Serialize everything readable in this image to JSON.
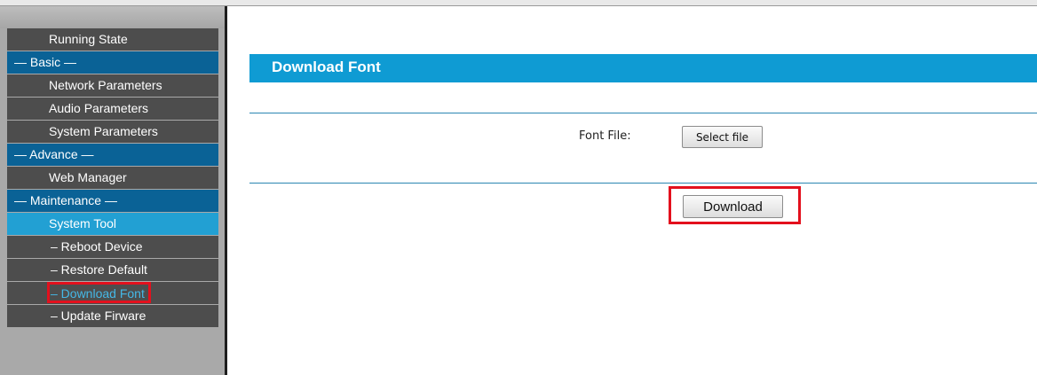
{
  "sidebar": {
    "items": [
      {
        "label": "Running State",
        "type": "item"
      },
      {
        "label": "— Basic —",
        "type": "section"
      },
      {
        "label": "Network Parameters",
        "type": "item"
      },
      {
        "label": "Audio Parameters",
        "type": "item"
      },
      {
        "label": "System Parameters",
        "type": "item"
      },
      {
        "label": "— Advance —",
        "type": "section"
      },
      {
        "label": "Web Manager",
        "type": "item"
      },
      {
        "label": "— Maintenance —",
        "type": "section"
      },
      {
        "label": "System Tool",
        "type": "active"
      },
      {
        "label": "– Reboot Device",
        "type": "sub"
      },
      {
        "label": "– Restore Default",
        "type": "sub"
      },
      {
        "label": "– Download Font",
        "type": "sub",
        "current": true
      },
      {
        "label": "– Update Firware",
        "type": "sub"
      }
    ]
  },
  "main": {
    "title": "Download Font",
    "font_file_label": "Font File:",
    "select_file_label": "Select file",
    "download_label": "Download"
  },
  "colors": {
    "title_bar": "#0f9bd3",
    "section": "#0a6296",
    "active": "#22a0d3",
    "highlight": "#e3101d"
  }
}
